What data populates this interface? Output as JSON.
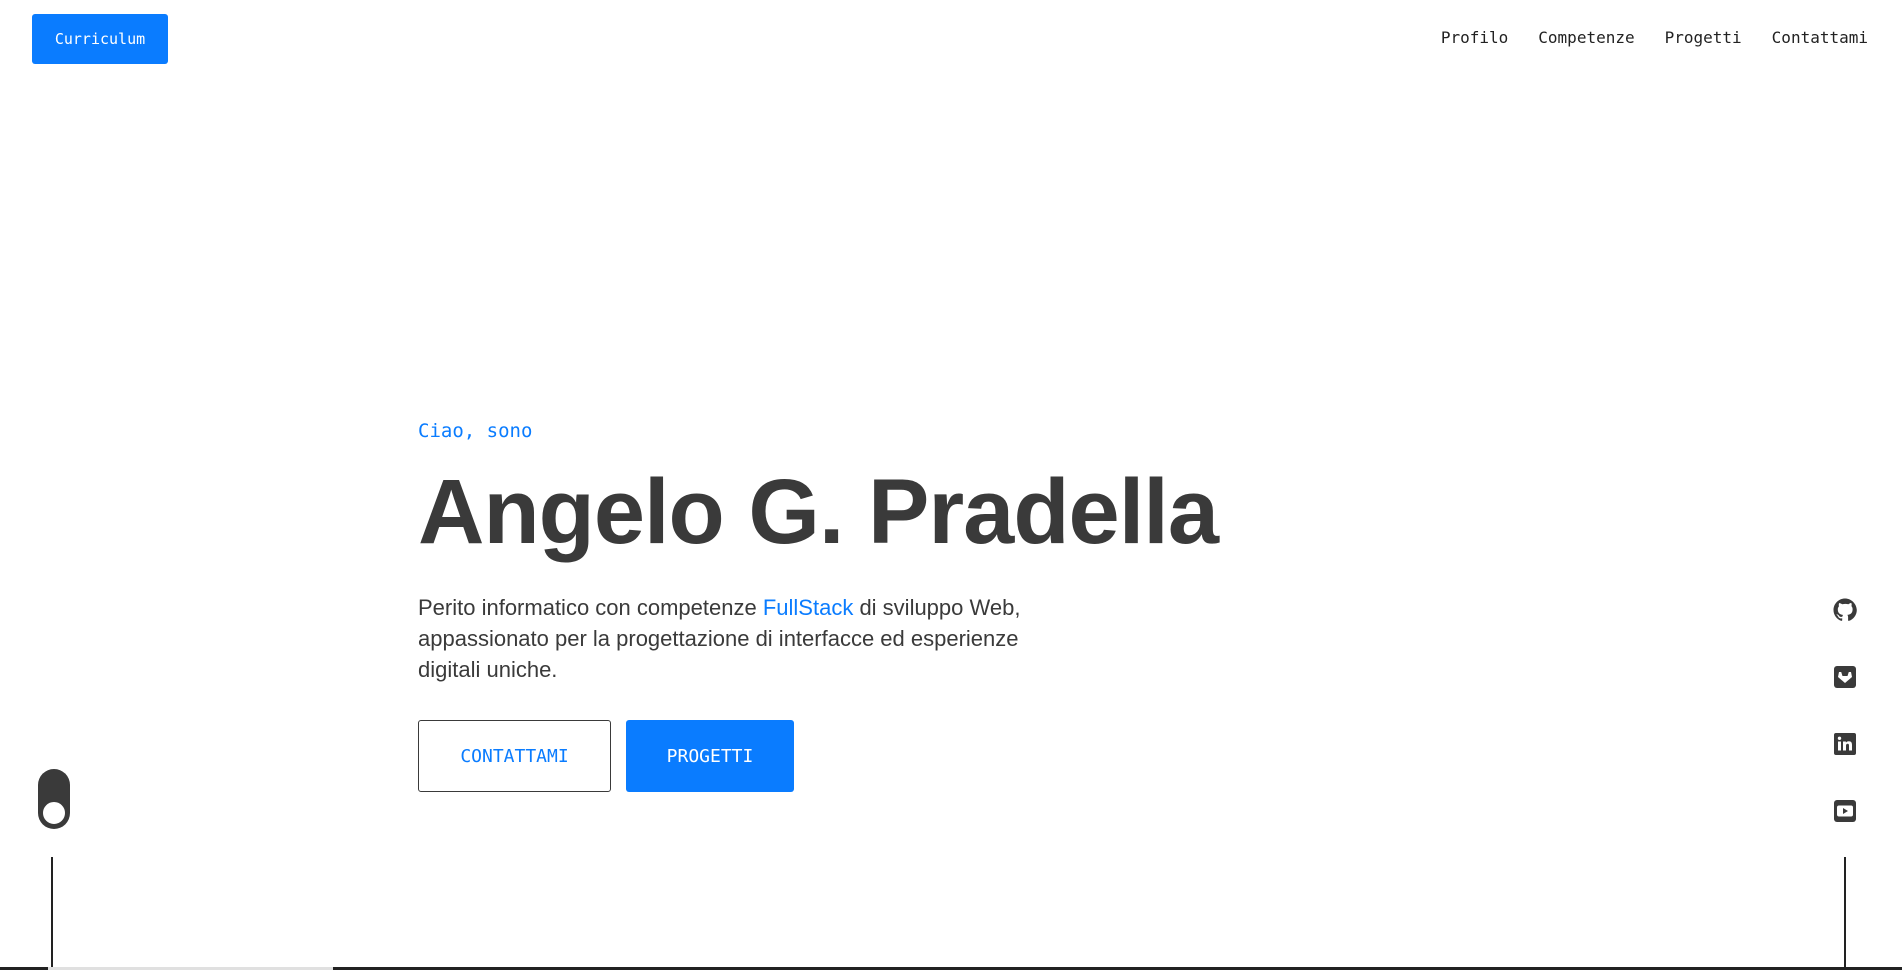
{
  "header": {
    "cv_label": "Curriculum",
    "nav": [
      {
        "label": "Profilo"
      },
      {
        "label": "Competenze"
      },
      {
        "label": "Progetti"
      },
      {
        "label": "Contattami"
      }
    ]
  },
  "hero": {
    "greeting": "Ciao, sono",
    "name": "Angelo G. Pradella",
    "bio_before": "Perito informatico con competenze ",
    "bio_highlight": "FullStack",
    "bio_after": " di sviluppo Web, appassionato per la progettazione di interfacce ed esperienze digitali uniche.",
    "contact_button": "CONTATTAMI",
    "projects_button": "PROGETTI"
  },
  "social": [
    {
      "icon": "github-icon"
    },
    {
      "icon": "gitlab-icon"
    },
    {
      "icon": "linkedin-icon"
    },
    {
      "icon": "youtube-icon"
    }
  ],
  "colors": {
    "accent": "#0a7cff",
    "text": "#3a3a3a",
    "background": "#ffffff"
  }
}
